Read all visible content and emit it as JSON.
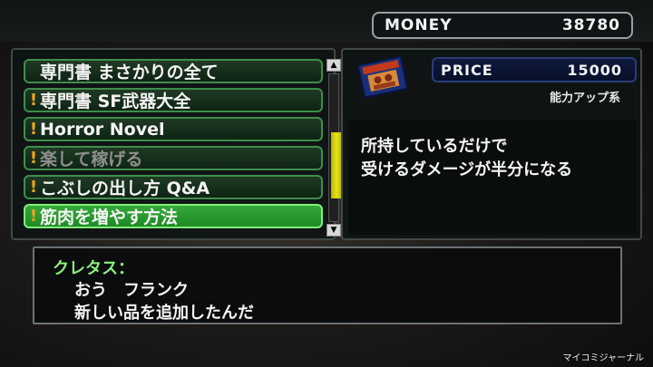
{
  "money": {
    "label": "MONEY",
    "value": "38780"
  },
  "shop_list": {
    "items": [
      {
        "label": "専門書 まさかりの全て",
        "new": false,
        "dim": false,
        "selected": false
      },
      {
        "label": "専門書 SF武器大全",
        "new": true,
        "dim": false,
        "selected": false
      },
      {
        "label": "Horror Novel",
        "new": true,
        "dim": false,
        "selected": false
      },
      {
        "label": "楽して稼げる",
        "new": true,
        "dim": true,
        "selected": false
      },
      {
        "label": "こぶしの出し方 Q&A",
        "new": true,
        "dim": false,
        "selected": false
      },
      {
        "label": "筋肉を増やす方法",
        "new": true,
        "dim": false,
        "selected": true
      }
    ],
    "scroll_position": 0.72,
    "scroll_thumb_fraction": 0.45
  },
  "item_info": {
    "price_label": "PRICE",
    "price_value": "15000",
    "category": "能力アップ系",
    "icon": "book-cover-icon",
    "description": [
      "所持しているだけで",
      "受けるダメージが半分になる"
    ]
  },
  "dialog": {
    "speaker": "クレタス：",
    "lines": [
      "おう　フランク",
      "新しい品を追加したんだ"
    ]
  },
  "watermark": "マイコミジャーナル",
  "colors": {
    "selected_item": "#2e9e32",
    "item_border": "#3f8e4c",
    "new_mark": "#f2a21c",
    "scroll_thumb": "#e0de1a",
    "speaker": "#8ef07c",
    "price_box": "#0e1a3c"
  }
}
